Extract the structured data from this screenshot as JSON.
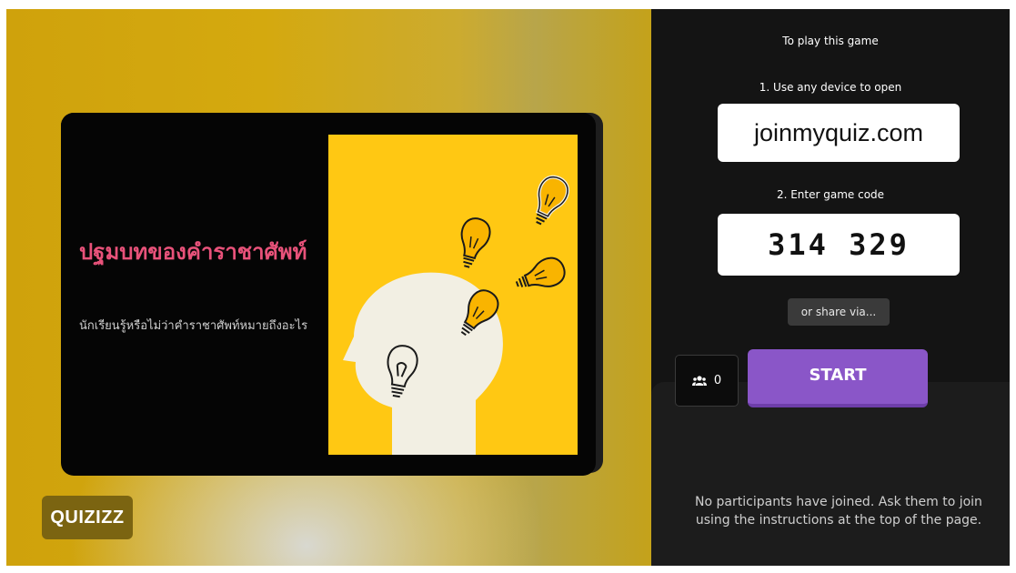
{
  "card": {
    "title": "ปฐมบทของคำราชาศัพท์",
    "description": "นักเรียนรู้หรือไม่ว่าคำราชาศัพท์หมายถึงอะไร"
  },
  "logo": {
    "text": "QUIZIZZ"
  },
  "join_panel": {
    "heading": "To play this game",
    "step1": "1. Use any device to open",
    "url": "joinmyquiz.com",
    "step2": "2. Enter game code",
    "game_code": "314 329",
    "share_label": "or share via...",
    "participant_count": "0",
    "start_label": "START",
    "empty_message": "No participants have joined. Ask them to join using the instructions at the top of the page."
  },
  "icons": [
    "users-icon",
    "lightbulb-icon",
    "head-silhouette-icon"
  ],
  "colors": {
    "accent": "#8a56c8",
    "title": "#e8527a",
    "yellow": "#ffc813"
  }
}
